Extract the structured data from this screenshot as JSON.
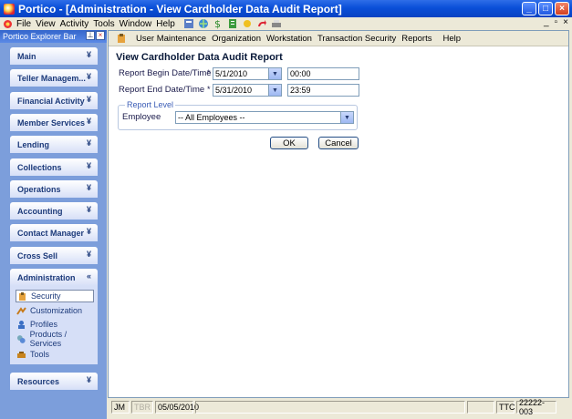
{
  "window": {
    "title": "Portico - [Administration - View Cardholder Data Audit Report]",
    "buttons": {
      "minimize": "_",
      "maximize": "□",
      "close": "×"
    }
  },
  "menubar": {
    "items": [
      "File",
      "View",
      "Activity",
      "Tools",
      "Window",
      "Help"
    ],
    "mdi_buttons": [
      "_",
      "▫",
      "×"
    ]
  },
  "explorer": {
    "title": "Portico Explorer Bar",
    "groups": [
      {
        "label": "Main",
        "chevron": "¥"
      },
      {
        "label": "Teller Managem...",
        "chevron": "¥"
      },
      {
        "label": "Financial Activity",
        "chevron": "¥"
      },
      {
        "label": "Member Services",
        "chevron": "¥"
      },
      {
        "label": "Lending",
        "chevron": "¥"
      },
      {
        "label": "Collections",
        "chevron": "¥"
      },
      {
        "label": "Operations",
        "chevron": "¥"
      },
      {
        "label": "Accounting",
        "chevron": "¥"
      },
      {
        "label": "Contact Manager",
        "chevron": "¥"
      },
      {
        "label": "Cross Sell",
        "chevron": "¥"
      },
      {
        "label": "Administration",
        "chevron": "«"
      },
      {
        "label": "Resources",
        "chevron": "¥"
      }
    ],
    "admin_items": [
      {
        "label": "Security",
        "icon": "security-icon"
      },
      {
        "label": "Customization",
        "icon": "customization-icon"
      },
      {
        "label": "Profiles",
        "icon": "profiles-icon"
      },
      {
        "label": "Products / Services",
        "icon": "products-icon"
      },
      {
        "label": "Tools",
        "icon": "tools-icon"
      }
    ]
  },
  "subnav": {
    "items": [
      "User Maintenance",
      "Organization",
      "Workstation",
      "Transaction Security",
      "Reports",
      "Help"
    ]
  },
  "form": {
    "title": "View Cardholder Data Audit Report",
    "begin_label": "Report Begin Date/Time",
    "end_label": "Report End Date/Time",
    "required_mark": "*",
    "begin_date": "5/1/2010",
    "begin_time": "00:00",
    "end_date": "5/31/2010",
    "end_time": "23:59",
    "report_level_legend": "Report Level",
    "employee_label": "Employee",
    "employee_value": "-- All Employees --",
    "ok_label": "OK",
    "cancel_label": "Cancel",
    "dropdown_arrow": "▼"
  },
  "statusbar": {
    "user": "JM",
    "muted": "TBR",
    "date": "05/05/2010",
    "ttc": "TTC",
    "code": "22222-003"
  }
}
